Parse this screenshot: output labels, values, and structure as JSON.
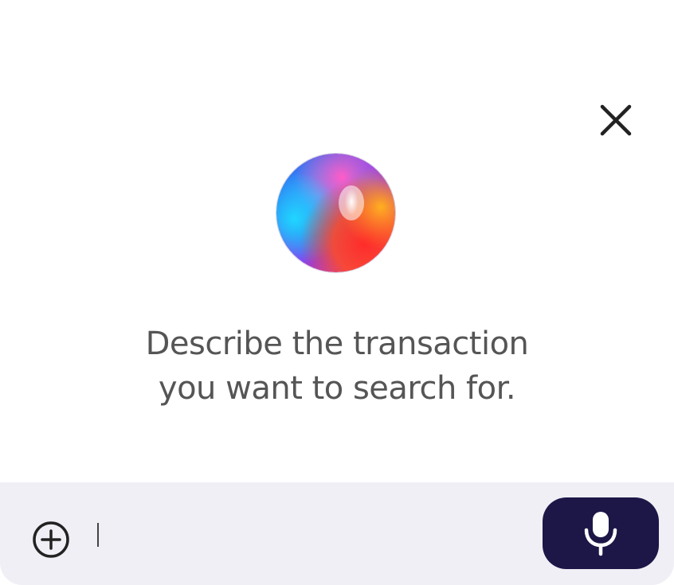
{
  "dialog": {
    "close_icon": "close-icon",
    "orb_icon": "ai-orb-icon",
    "prompt_line1": "Describe the transaction",
    "prompt_line2": "you want to search for."
  },
  "input_bar": {
    "add_icon": "plus-circle-icon",
    "input_value": "",
    "mic_icon": "microphone-icon",
    "mic_button_color": "#1c1747",
    "background_color": "#f0eff5"
  }
}
